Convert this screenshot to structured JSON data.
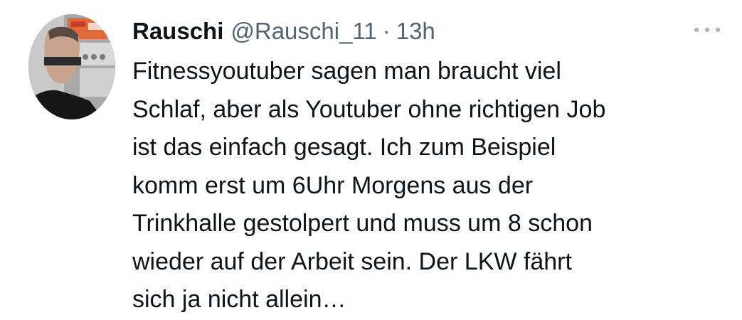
{
  "tweet": {
    "author": {
      "display_name": "Rauschi",
      "handle": "@Rauschi_11"
    },
    "separator": "·",
    "time": "13h",
    "text": "Fitnessyoutuber sagen man braucht viel\nSchlaf, aber als Youtuber ohne richtigen Job\nist das einfach gesagt. Ich zum Beispiel\nkomm erst um 6Uhr Morgens aus der\nTrinkhalle gestolpert und muss um 8 schon\nwieder auf der Arbeit sein. Der LKW fährt\nsich ja nicht allein…"
  },
  "icons": {
    "more": "more-dots-icon",
    "avatar": "profile-photo"
  },
  "colors": {
    "text_primary": "#0f1419",
    "text_secondary": "#536471",
    "more_icon": "#b0b6bb",
    "background": "#ffffff"
  }
}
